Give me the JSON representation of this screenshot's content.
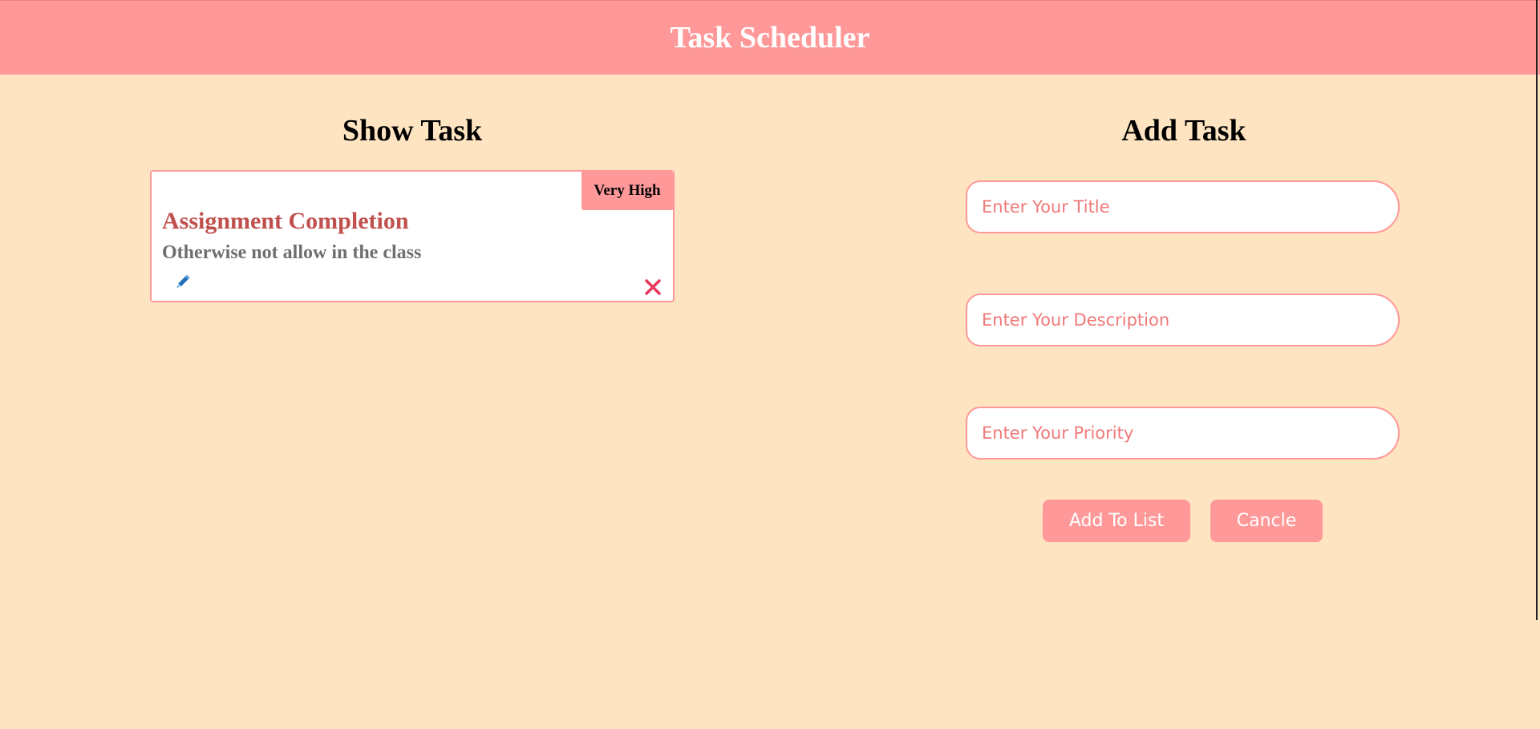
{
  "header": {
    "title": "Task Scheduler"
  },
  "show_section": {
    "title": "Show Task",
    "tasks": [
      {
        "priority": "Very High",
        "title": "Assignment Completion",
        "description": "Otherwise not allow in the class",
        "edit_icon": "pencil-icon",
        "delete_icon": "close-icon"
      }
    ]
  },
  "add_section": {
    "title": "Add Task",
    "title_placeholder": "Enter Your Title",
    "description_placeholder": "Enter Your Description",
    "priority_placeholder": "Enter Your Priority",
    "add_button": "Add To List",
    "cancel_button": "Cancle"
  },
  "colors": {
    "background": "#ffe4c2",
    "accent": "#ff9999",
    "task_title": "#c0504d",
    "delete": "#e8365d",
    "edit": "#1e6fb8"
  }
}
